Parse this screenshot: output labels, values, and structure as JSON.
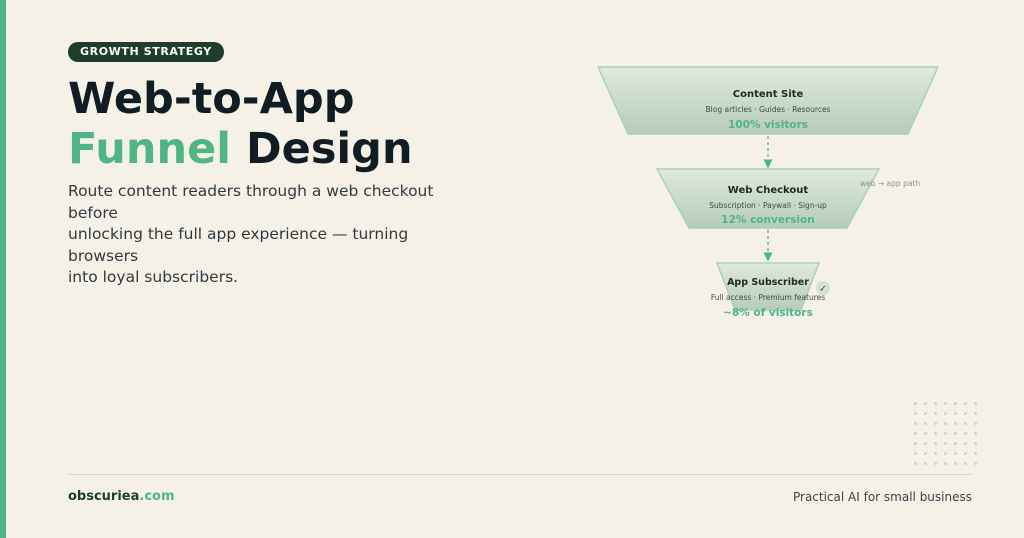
{
  "badge": "GROWTH STRATEGY",
  "title": {
    "line1": "Web-to-App",
    "line2_accent": "Funnel",
    "line2_rest": "Design"
  },
  "description": [
    "Route content readers through a web checkout",
    "before",
    "unlocking the full app experience — turning",
    "browsers",
    "into loyal subscribers."
  ],
  "funnel": {
    "stages": [
      {
        "name": "Content Site",
        "detail": "Blog articles · Guides · Resources",
        "metric": "100% visitors"
      },
      {
        "name": "Web Checkout",
        "detail": "Subscription · Paywall · Sign-up",
        "metric": "12% conversion"
      },
      {
        "name": "App Subscriber",
        "detail": "Full access · Premium features",
        "metric": "~8% of visitors"
      }
    ],
    "path_label": "web → app path",
    "check_mark": "✓"
  },
  "footer": {
    "brand_name": "obscuriea",
    "brand_tld": ".com",
    "tagline": "Practical AI for small business"
  },
  "colors": {
    "accent": "#4fb584",
    "dark_green": "#1e3d2c",
    "background": "#f6f1e7",
    "title": "#121c24"
  }
}
